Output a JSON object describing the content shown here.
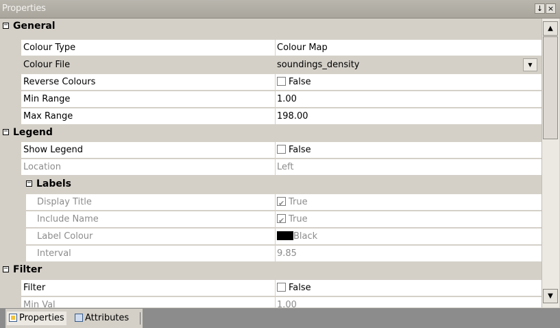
{
  "window": {
    "title": "Properties",
    "pin_icon": "pin-icon",
    "close_icon": "close-icon",
    "pin_glyph": "↓",
    "close_glyph": "×"
  },
  "glyphs": {
    "collapse": "−",
    "dropdown": "▼",
    "up": "▲",
    "down": "▼"
  },
  "grid": {
    "general": {
      "label": "General",
      "rows": {
        "colour_type": {
          "name": "Colour Type",
          "value": "Colour Map"
        },
        "colour_file": {
          "name": "Colour File",
          "value": "soundings_density"
        },
        "reverse_colours": {
          "name": "Reverse Colours",
          "value": "False",
          "checked": false
        },
        "min_range": {
          "name": "Min Range",
          "value": "1.00"
        },
        "max_range": {
          "name": "Max Range",
          "value": "198.00"
        }
      }
    },
    "legend": {
      "label": "Legend",
      "rows": {
        "show_legend": {
          "name": "Show Legend",
          "value": "False",
          "checked": false
        },
        "location": {
          "name": "Location",
          "value": "Left"
        }
      },
      "labels": {
        "label": "Labels",
        "rows": {
          "display_title": {
            "name": "Display Title",
            "value": "True",
            "checked": true
          },
          "include_name": {
            "name": "Include Name",
            "value": "True",
            "checked": true
          },
          "label_colour": {
            "name": "Label Colour",
            "value": "Black",
            "swatch": "#000000"
          },
          "interval": {
            "name": "Interval",
            "value": "9.85"
          }
        }
      }
    },
    "filter": {
      "label": "Filter",
      "rows": {
        "filter": {
          "name": "Filter",
          "value": "False",
          "checked": false
        },
        "min_val": {
          "name": "Min Val",
          "value": "1.00"
        }
      }
    }
  },
  "tabs": {
    "properties": {
      "label": "Properties",
      "icon": "properties-icon"
    },
    "attributes": {
      "label": "Attributes",
      "icon": "attributes-icon"
    }
  },
  "colors": {
    "panel": "#d4d0c8",
    "tabbar": "#8c8c8c",
    "disabled_text": "#8c8c8c"
  }
}
